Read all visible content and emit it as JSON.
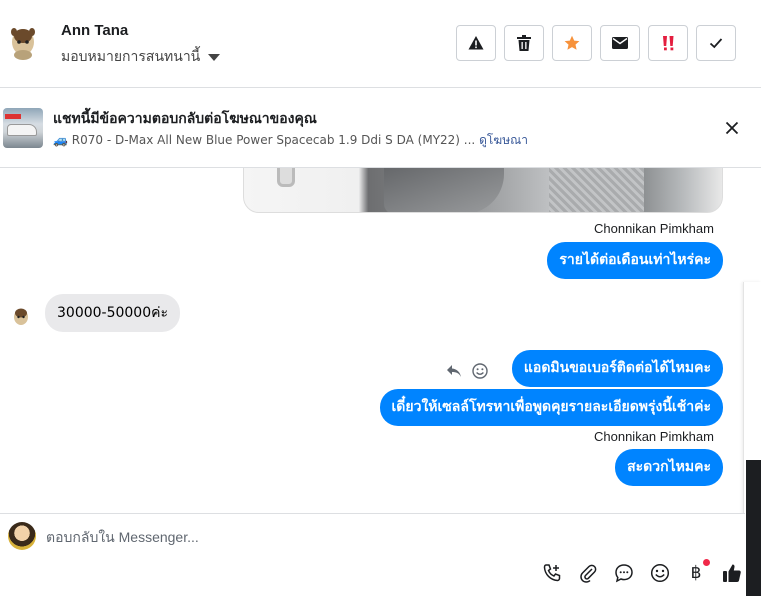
{
  "header": {
    "contact_name": "Ann Tana",
    "assign_label": "มอบหมายการสนทนานี้",
    "actions": [
      {
        "name": "report-spam",
        "icon": "warning-icon"
      },
      {
        "name": "delete",
        "icon": "trash-icon"
      },
      {
        "name": "star",
        "icon": "star-icon",
        "color": "#f7923b"
      },
      {
        "name": "mark-unread",
        "icon": "envelope-icon"
      },
      {
        "name": "follow-up",
        "icon": "exclamation-icon",
        "color": "#e41e3f"
      },
      {
        "name": "done",
        "icon": "check-icon"
      }
    ]
  },
  "ad": {
    "title": "แชทนี้มีข้อความตอบกลับต่อโฆษณาของคุณ",
    "vehicle_icon": "🚙",
    "subtitle": "R070 - D-Max All New Blue Power Spacecab 1.9 Ddi S DA (MY22) ...",
    "link": "ดูโฆษณา"
  },
  "messages": {
    "sender_1": "Chonnikan Pimkham",
    "out_1": "รายได้ต่อเดือนเท่าไหร่คะ",
    "in_1": "30000-50000ค่ะ",
    "out_2": "แอดมินขอเบอร์ติดต่อได้ไหมคะ",
    "out_3": "เดี๋ยวให้เซลล์โทรหาเพื่อพูดคุยรายละเอียดพรุ่งนี้เช้าค่ะ",
    "sender_2": "Chonnikan Pimkham",
    "out_4": "สะดวกไหมคะ"
  },
  "composer": {
    "placeholder": "ตอบกลับใน Messenger...",
    "currency_symbol": "฿",
    "tools": [
      "phone-add-icon",
      "paperclip-icon",
      "chat-bubble-icon",
      "smiley-icon",
      "baht-icon",
      "thumbs-up-icon"
    ]
  },
  "colors": {
    "bubble_out": "#0084ff",
    "bubble_in": "#e9e9eb",
    "link": "#385898",
    "star": "#f7923b",
    "alert": "#e41e3f"
  }
}
